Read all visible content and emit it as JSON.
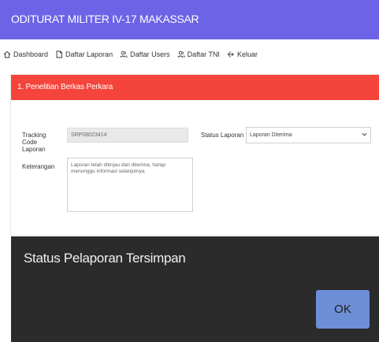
{
  "app": {
    "title": "ODITURAT MILITER IV-17 MAKASSAR"
  },
  "nav": {
    "items": [
      {
        "label": "Dashboard",
        "icon": "home-icon"
      },
      {
        "label": "Daftar Laporan",
        "icon": "document-icon"
      },
      {
        "label": "Daftar Users",
        "icon": "users-icon"
      },
      {
        "label": "Daftar TNI",
        "icon": "users-icon"
      },
      {
        "label": "Keluar",
        "icon": "logout-icon"
      }
    ]
  },
  "card": {
    "title": "1. Penelitian Berkas Perkara",
    "tracking_code": {
      "label": "Tracking Code Laporan",
      "value": "SRP08023414"
    },
    "status": {
      "label": "Status Laporan",
      "value": "Laporan Diterima"
    },
    "keterangan": {
      "label": "Keterangan",
      "value": "Laporan telah ditinjau dan diterima, harap menunggu informasi selanjutnya"
    }
  },
  "dialog": {
    "message": "Status Pelaporan Tersimpan",
    "ok_label": "OK"
  },
  "colors": {
    "topbar": "#6c63e6",
    "card_header": "#f4443b",
    "dialog_bg": "#2b2b2b",
    "ok_button": "#6c8fd7"
  }
}
